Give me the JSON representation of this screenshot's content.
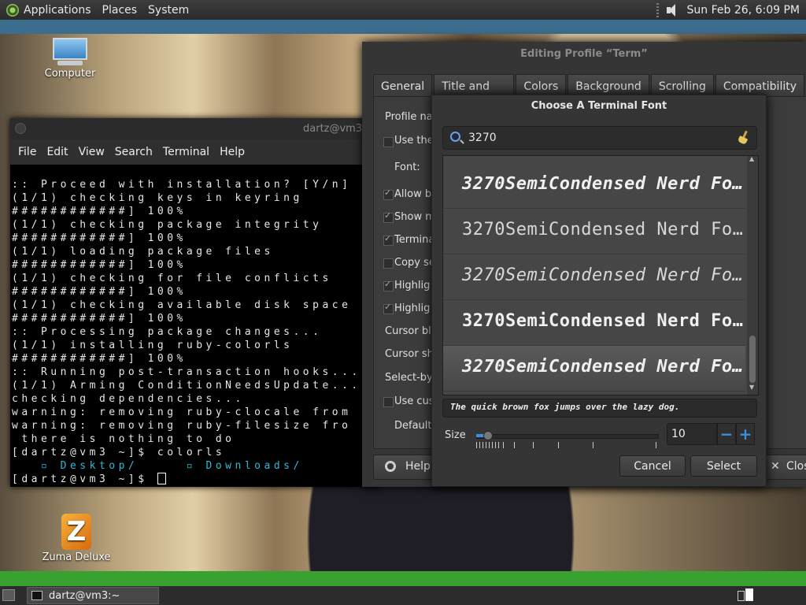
{
  "top_panel": {
    "menus": [
      "Applications",
      "Places",
      "System"
    ],
    "clock": "Sun Feb 26,  6:09 PM"
  },
  "desktop": {
    "icons": [
      {
        "label": "Computer",
        "glyph": "computer-icon"
      },
      {
        "label": "Zuma Deluxe",
        "glyph": "zuma-icon"
      }
    ]
  },
  "terminal": {
    "title": "dartz@vm3:",
    "menu": [
      "File",
      "Edit",
      "View",
      "Search",
      "Terminal",
      "Help"
    ],
    "lines": [
      ":: Proceed with installation? [Y/n]",
      "(1/1) checking keys in keyring",
      "############] 100%",
      "(1/1) checking package integrity",
      "############] 100%",
      "(1/1) loading package files",
      "############] 100%",
      "(1/1) checking for file conflicts",
      "############] 100%",
      "(1/1) checking available disk space",
      "############] 100%",
      ":: Processing package changes...",
      "(1/1) installing ruby-colorls",
      "############] 100%",
      ":: Running post-transaction hooks...",
      "(1/1) Arming ConditionNeedsUpdate...",
      "checking dependencies...",
      "warning: removing ruby-clocale from",
      "warning: removing ruby-filesize fro",
      " there is nothing to do",
      "[dartz@vm3 ~]$ colorls"
    ],
    "colorls_output": "   ▫ Desktop/     ▫ Downloads/",
    "prompt": "[dartz@vm3 ~]$ "
  },
  "profile_dialog": {
    "title": "Editing Profile “Term”",
    "tabs": [
      "General",
      "Title and Command",
      "Colors",
      "Background",
      "Scrolling",
      "Compatibility"
    ],
    "active_tab": "General",
    "rows": {
      "profile_name": "Profile nar",
      "use_the": "Use the",
      "font": "Font:",
      "allow_bold": "Allow bo",
      "show_menubar": "Show m",
      "terminal_bell": "Termina",
      "copy_selection": "Copy se",
      "highlight1": "Highlig",
      "highlight2": "Highlig",
      "cursor_blink": "Cursor bli",
      "cursor_shape": "Cursor sha",
      "select_by": "Select-by-",
      "use_custom": "Use cust",
      "default": "Default"
    },
    "help_label": "Help",
    "close_label": "Clos"
  },
  "font_dialog": {
    "title": "Choose A Terminal Font",
    "search_value": "3270",
    "fonts": [
      "3270SemiCondensed Nerd Fo…",
      "3270SemiCondensed Nerd Fo…",
      "3270SemiCondensed Nerd Fo…",
      "3270SemiCondensed Nerd Fo…",
      "3270SemiCondensed Nerd Fo…"
    ],
    "selected_index": 4,
    "preview_text": "The quick brown fox jumps over the lazy dog.",
    "size_label": "Size",
    "size_value": "10",
    "minus": "−",
    "plus": "+",
    "cancel_label": "Cancel",
    "select_label": "Select"
  },
  "taskbar": {
    "task_label": "dartz@vm3:~"
  }
}
